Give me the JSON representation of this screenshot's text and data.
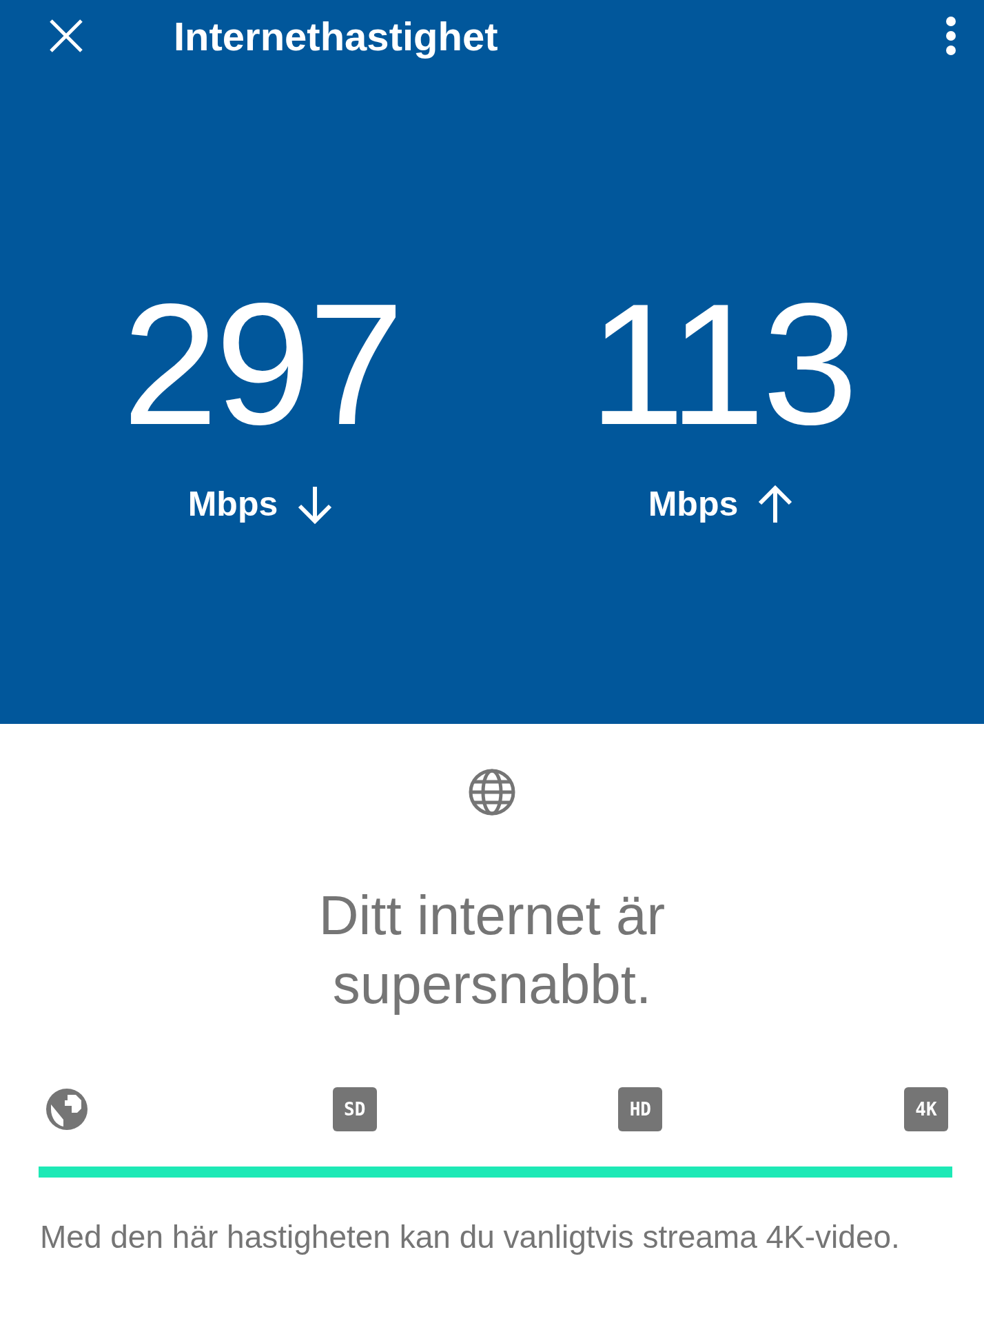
{
  "app_bar": {
    "title": "Internethastighet"
  },
  "speeds": [
    {
      "value": "297",
      "unit": "Mbps",
      "kind": "down"
    },
    {
      "value": "113",
      "unit": "Mbps",
      "kind": "up"
    }
  ],
  "result": {
    "heading": "Ditt internet är supersnabbt."
  },
  "quality_scale": {
    "tiers": [
      {
        "kind": "globe"
      },
      {
        "kind": "badge",
        "label": "SD"
      },
      {
        "kind": "badge",
        "label": "HD"
      },
      {
        "kind": "badge",
        "label": "4K"
      }
    ],
    "level": 1
  },
  "description": "Med den här hastigheten kan du vanligtvis streama 4K-video."
}
